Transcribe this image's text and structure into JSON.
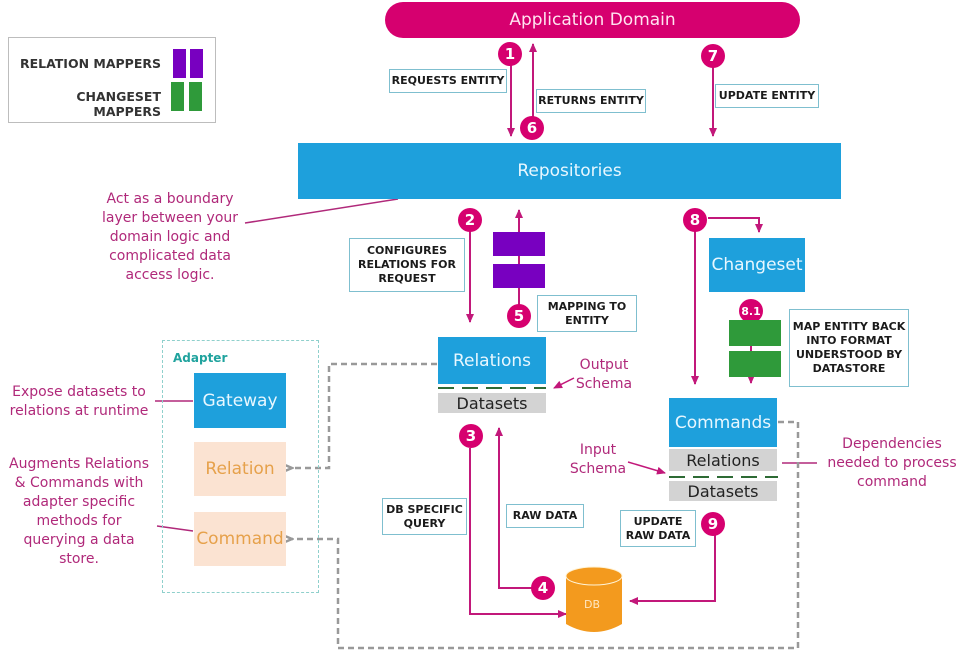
{
  "legend": {
    "items": [
      {
        "label": "RELATION MAPPERS",
        "color": "#7800c0"
      },
      {
        "label": "CHANGESET MAPPERS",
        "color": "#2f9a3a"
      }
    ]
  },
  "nodes": {
    "application_domain": "Application Domain",
    "repositories": "Repositories",
    "changeset": "Changeset",
    "relations": "Relations",
    "relations_datasets": "Datasets",
    "commands": "Commands",
    "commands_relations": "Relations",
    "commands_datasets": "Datasets",
    "db": "DB",
    "adapter": {
      "title": "Adapter",
      "gateway": "Gateway",
      "relation": "Relation",
      "command": "Command"
    }
  },
  "steps": [
    {
      "num": "1",
      "label": "REQUESTS ENTITY"
    },
    {
      "num": "2",
      "label": "CONFIGURES RELATIONS FOR REQUEST"
    },
    {
      "num": "3",
      "label": "DB SPECIFIC QUERY"
    },
    {
      "num": "4",
      "label": "RAW DATA"
    },
    {
      "num": "5",
      "label": "MAPPING TO ENTITY"
    },
    {
      "num": "6",
      "label": "RETURNS ENTITY"
    },
    {
      "num": "7",
      "label": "UPDATE ENTITY"
    },
    {
      "num": "8",
      "label": ""
    },
    {
      "num": "8.1",
      "label": "MAP ENTITY BACK INTO FORMAT UNDERSTOOD BY DATASTORE"
    },
    {
      "num": "9",
      "label": "UPDATE RAW DATA"
    }
  ],
  "notes": {
    "repositories": "Act as a boundary layer between your domain logic and complicated data access logic.",
    "gateway": "Expose datasets to relations at runtime",
    "adapter_ext": "Augments Relations & Commands with adapter specific methods for querying a data store.",
    "output_schema": "Output Schema",
    "input_schema": "Input Schema",
    "dependencies": "Dependencies needed to process command"
  },
  "colors": {
    "accent": "#d6006f",
    "blue": "#1ea0dc",
    "relation_mapper": "#7800c0",
    "changeset_mapper": "#2f9a3a",
    "db": "#f39a1e"
  }
}
